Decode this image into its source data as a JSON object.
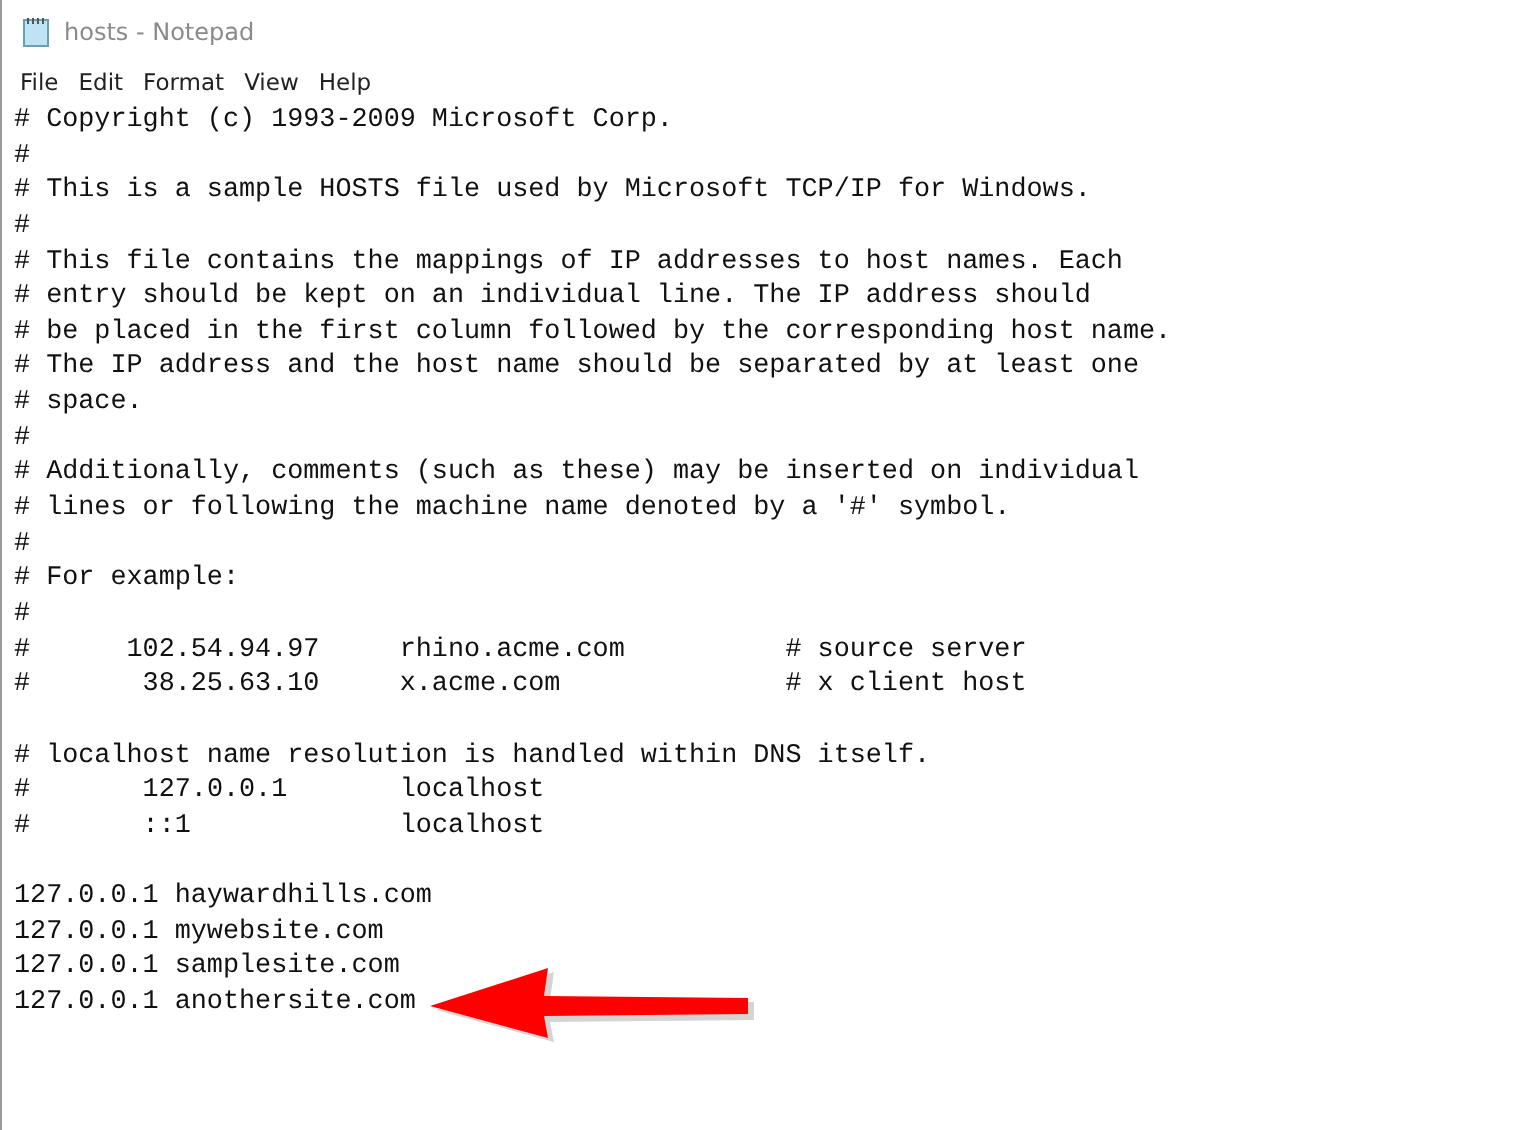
{
  "window": {
    "title": "hosts - Notepad"
  },
  "menu": [
    "File",
    "Edit",
    "Format",
    "View",
    "Help"
  ],
  "editor": {
    "text": "# Copyright (c) 1993-2009 Microsoft Corp.\n#\n# This is a sample HOSTS file used by Microsoft TCP/IP for Windows.\n#\n# This file contains the mappings of IP addresses to host names. Each\n# entry should be kept on an individual line. The IP address should\n# be placed in the first column followed by the corresponding host name.\n# The IP address and the host name should be separated by at least one\n# space.\n#\n# Additionally, comments (such as these) may be inserted on individual\n# lines or following the machine name denoted by a '#' symbol.\n#\n# For example:\n#\n#      102.54.94.97     rhino.acme.com          # source server\n#       38.25.63.10     x.acme.com              # x client host\n\n# localhost name resolution is handled within DNS itself.\n#\t127.0.0.1       localhost\n#\t::1             localhost\n\n127.0.0.1 haywardhills.com\n127.0.0.1 mywebsite.com\n127.0.0.1 samplesite.com\n127.0.0.1 anothersite.com"
  }
}
